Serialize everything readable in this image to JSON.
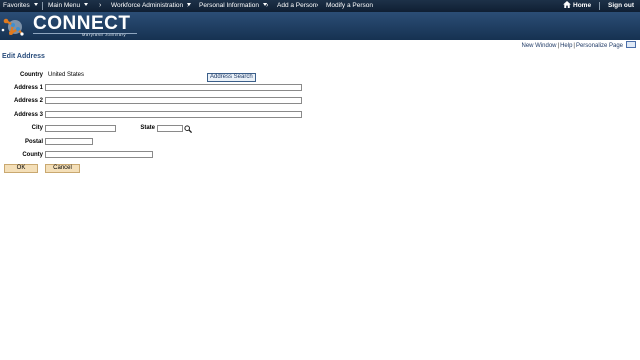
{
  "nav": {
    "favorites": "Favorites",
    "main_menu": "Main Menu",
    "workforce_admin": "Workforce Administration",
    "personal_info": "Personal Information",
    "add_person": "Add a Person",
    "modify_person": "Modify a Person",
    "home": "Home",
    "sign_out": "Sign out"
  },
  "banner": {
    "brand": "CONNECT",
    "subtitle": "Maryland Judiciary"
  },
  "tools": {
    "new_window": "New Window",
    "help": "Help",
    "personalize": "Personalize Page"
  },
  "page_title": "Edit Address",
  "form": {
    "country_label": "Country",
    "country_value": "United States",
    "address_search": "Address Search",
    "address1_label": "Address 1",
    "address2_label": "Address 2",
    "address3_label": "Address 3",
    "city_label": "City",
    "state_label": "State",
    "postal_label": "Postal",
    "county_label": "County",
    "address1_value": "",
    "address2_value": "",
    "address3_value": "",
    "city_value": "",
    "state_value": "",
    "postal_value": "",
    "county_value": ""
  },
  "buttons": {
    "ok": "OK",
    "cancel": "Cancel"
  },
  "colors": {
    "nav_bg": "#132539",
    "banner_bg": "#21436a",
    "title_color": "#2a4d7c",
    "button_bg": "#f4dfb8"
  }
}
